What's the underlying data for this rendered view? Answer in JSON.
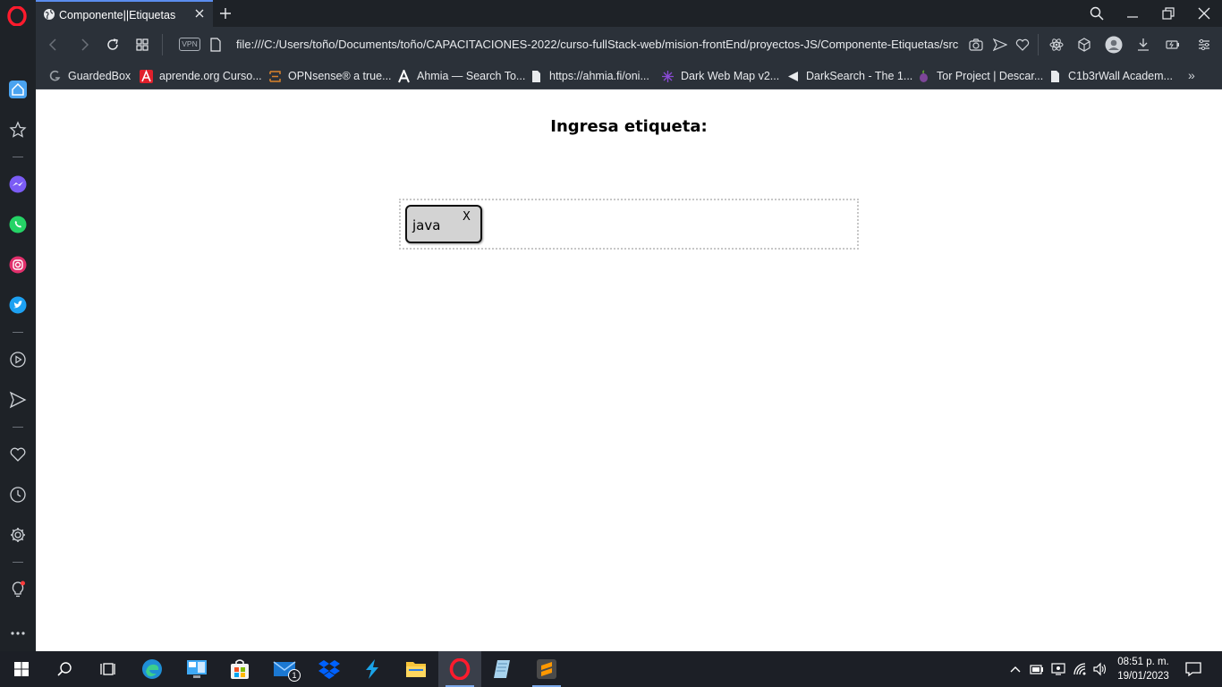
{
  "browser": {
    "tab_title": "Componente||Etiquetas",
    "url": "file:///C:/Users/toño/Documents/toño/CAPACITACIONES-2022/curso-fullStack-web/mision-frontEnd/proyectos-JS/Componente-Etiquetas/src",
    "vpn_label": "VPN",
    "bookmarks": [
      {
        "label": "GuardedBox",
        "icon": "guardedbox-icon"
      },
      {
        "label": "aprende.org Curso...",
        "icon": "aprende-icon"
      },
      {
        "label": "OPNsense® a true...",
        "icon": "opnsense-icon"
      },
      {
        "label": "Ahmia — Search To...",
        "icon": "ahmia-icon"
      },
      {
        "label": "https://ahmia.fi/oni...",
        "icon": "page-icon"
      },
      {
        "label": "Dark Web Map v2...",
        "icon": "darkwebmap-icon"
      },
      {
        "label": "DarkSearch - The 1...",
        "icon": "darksearch-icon"
      },
      {
        "label": "Tor Project | Descar...",
        "icon": "tor-icon"
      },
      {
        "label": "C1b3rWall Academ...",
        "icon": "page-icon"
      }
    ],
    "bookmarks_more": "»"
  },
  "page": {
    "title": "Ingresa etiqueta:",
    "tags": [
      {
        "text": "java",
        "remove_label": "X"
      }
    ]
  },
  "taskbar": {
    "time": "08:51 p. m.",
    "date": "19/01/2023",
    "mail_badge": "1"
  },
  "colors": {
    "chrome_dark": "#1e2227",
    "chrome": "#2b3139",
    "accent": "#5b8def",
    "opera_red": "#ff1b2d",
    "tag_bg": "#d3d3d3"
  }
}
